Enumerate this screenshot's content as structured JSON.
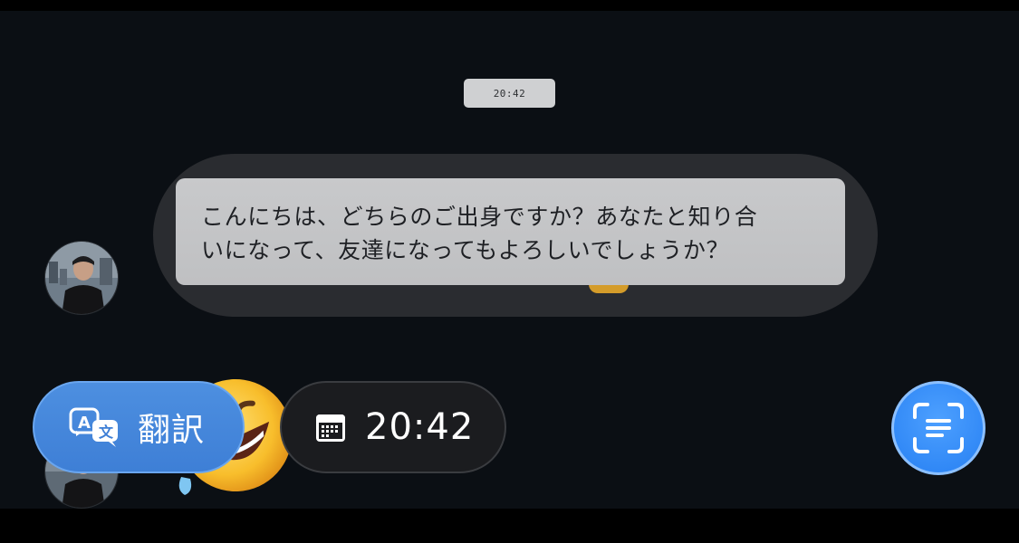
{
  "chat": {
    "timestamp": "20:42",
    "message": {
      "text": "こんにちは、どちらのご出身ですか？あなたと知り合いになって、友達になってもよろしいでしょうか？",
      "line1": "こんにちは、どちらのご出身ですか？あなたと知り合",
      "line2": "いになって、友達になってもよろしいでしょうか？"
    }
  },
  "actions": {
    "translate_label": "翻訳",
    "time_label": "20:42"
  },
  "icons": {
    "translate": "translate-icon",
    "calendar": "calendar-icon",
    "scan": "scan-text-icon",
    "emoji": "rolling-on-floor-laughing-emoji"
  },
  "colors": {
    "background": "#0b0f14",
    "bubble": "#c8c9cb",
    "bubble_frame": "#2a2c30",
    "accent_blue": "#3e7fd6",
    "scan_blue": "#2e86f5",
    "chip_dark": "#1b1c1f"
  }
}
